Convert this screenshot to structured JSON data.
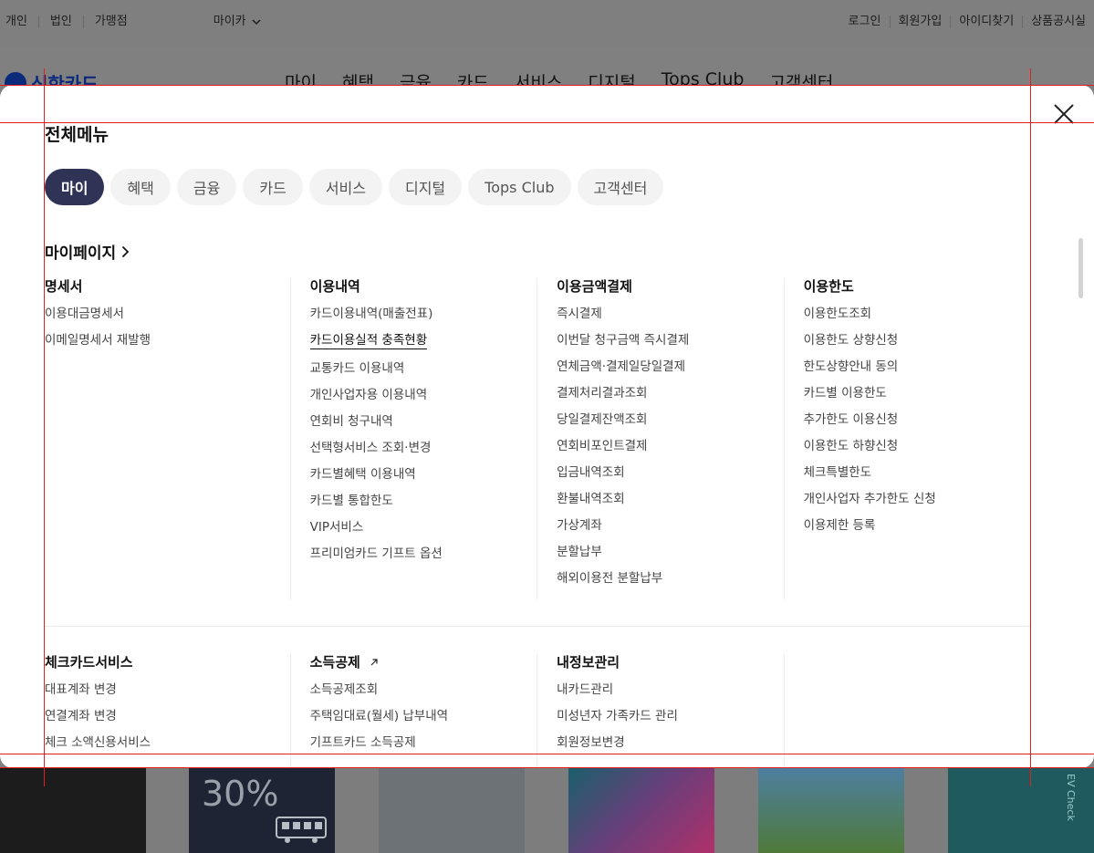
{
  "util": {
    "left": [
      "개인",
      "법인",
      "가맹점"
    ],
    "mycar": "마이카",
    "right": [
      "로그인",
      "회원가입",
      "아이디찾기",
      "상품공시실"
    ]
  },
  "logo": "신한카드",
  "gnb": [
    "마이",
    "혜택",
    "금융",
    "카드",
    "서비스",
    "디지털",
    "Tops Club",
    "고객센터"
  ],
  "modal": {
    "title": "전체메뉴",
    "tabs": [
      "마이",
      "혜택",
      "금융",
      "카드",
      "서비스",
      "디지털",
      "Tops Club",
      "고객센터"
    ],
    "active_tab": "마이",
    "section": "마이페이지",
    "group1": [
      {
        "title": "명세서",
        "items": [
          "이용대금명세서",
          "이메일명세서 재발행"
        ]
      },
      {
        "title": "이용내역",
        "items": [
          "카드이용내역(매출전표)",
          "카드이용실적 충족현황",
          "교통카드 이용내역",
          "개인사업자용 이용내역",
          "연회비 청구내역",
          "선택형서비스 조회·변경",
          "카드별혜택 이용내역",
          "카드별 통합한도",
          "VIP서비스",
          "프리미엄카드 기프트 옵션"
        ]
      },
      {
        "title": "이용금액결제",
        "items": [
          "즉시결제",
          "이번달 청구금액 즉시결제",
          "연체금액·결제일당일결제",
          "결제처리결과조회",
          "당일결제잔액조회",
          "연회비포인트결제",
          "입금내역조회",
          "환불내역조회",
          "가상계좌",
          "분할납부",
          "해외이용전 분할납부"
        ]
      },
      {
        "title": "이용한도",
        "items": [
          "이용한도조회",
          "이용한도 상향신청",
          "한도상향안내 동의",
          "카드별 이용한도",
          "추가한도 이용신청",
          "이용한도 하향신청",
          "체크특별한도",
          "개인사업자 추가한도 신청",
          "이용제한 등록"
        ]
      }
    ],
    "group2": [
      {
        "title": "체크카드서비스",
        "items": [
          "대표계좌 변경",
          "연결계좌 변경",
          "체크 소액신용서비스"
        ]
      },
      {
        "title": "소득공제",
        "items": [
          "소득공제조회",
          "주택임대료(월세) 납부내역",
          "기프트카드 소득공제"
        ]
      },
      {
        "title": "내정보관리",
        "items": [
          "내카드관리",
          "미성년자 가족카드 관리",
          "회원정보변경"
        ]
      },
      {
        "title": "",
        "items": []
      }
    ]
  },
  "bottom": {
    "discount": "30%",
    "ev": "EV Check"
  }
}
